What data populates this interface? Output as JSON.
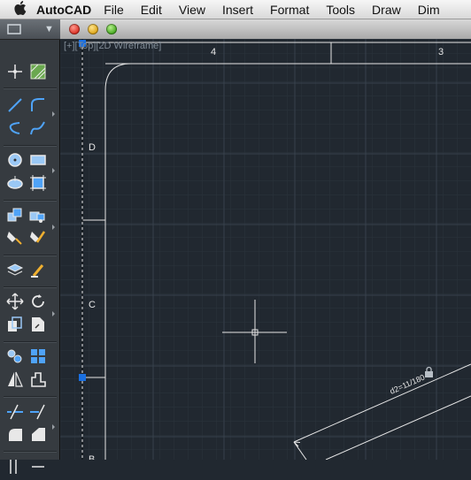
{
  "menubar": {
    "apple": "",
    "app_name": "AutoCAD",
    "items": [
      "File",
      "Edit",
      "View",
      "Insert",
      "Format",
      "Tools",
      "Draw",
      "Dim"
    ]
  },
  "viewport": {
    "label": "[+][Top][2D Wireframe]",
    "border_col_labels": [
      "4",
      "3"
    ],
    "border_row_labels": [
      "D",
      "C",
      "B"
    ],
    "dimension_text": "d2=11/180"
  },
  "palette": {
    "tools": [
      "select-tool-icon",
      "point-icon",
      "hatch-icon",
      "line-icon",
      "arc-icon",
      "polyline-icon",
      "spline-icon",
      "circle-icon",
      "rectangle-icon",
      "ellipse-icon",
      "region-icon",
      "insert-block-icon",
      "create-block-icon",
      "attribute-icon",
      "edit-attribute-icon",
      "layer-icon",
      "match-properties-icon",
      "move-icon",
      "rotate-icon",
      "copy-icon",
      "scale-icon",
      "array-icon",
      "group-icon",
      "mirror-icon",
      "stretch-icon",
      "trim-icon",
      "extend-icon",
      "fillet-icon",
      "chamfer-icon"
    ]
  },
  "colors": {
    "canvas": "#212830",
    "grid": "#2e3640",
    "grid_major": "#36404b",
    "lines": "#e6e6e6",
    "grip": "#1a6fe0"
  }
}
